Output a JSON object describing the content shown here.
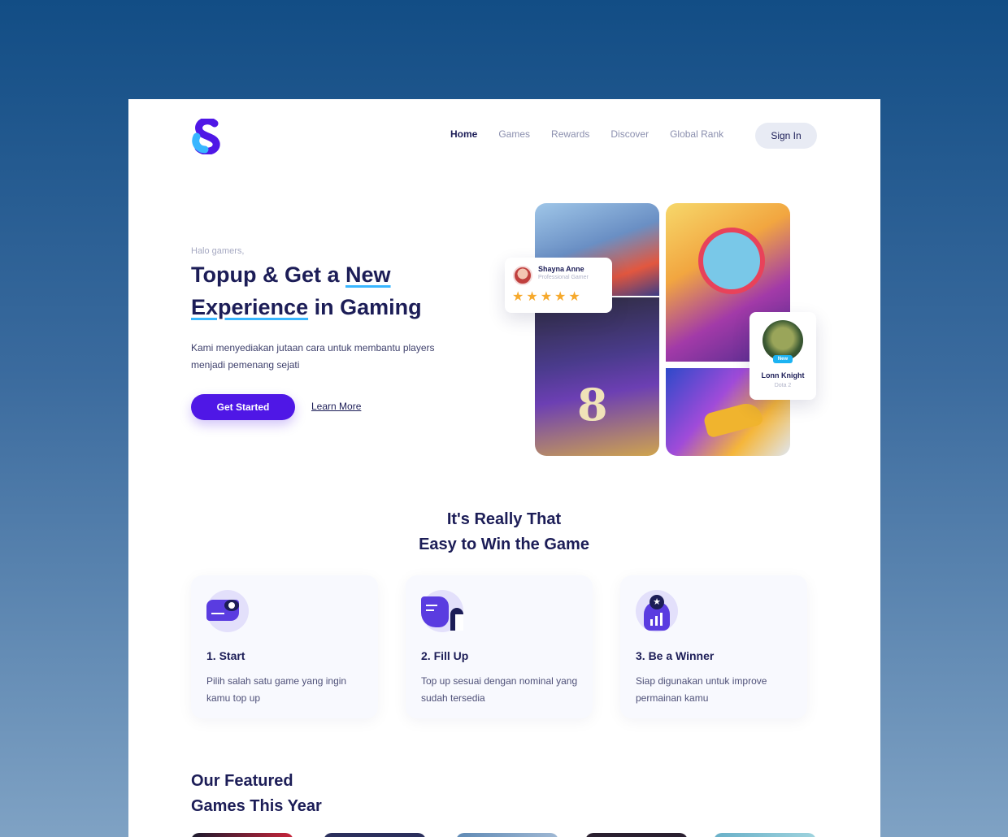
{
  "nav": {
    "items": [
      "Home",
      "Games",
      "Rewards",
      "Discover",
      "Global Rank"
    ],
    "active": "Home",
    "signin_label": "Sign In"
  },
  "brand": {
    "logo": "s-logo-icon",
    "primary": "#4f17e6",
    "accent": "#38b6ff",
    "text": "#1c1d57"
  },
  "hero": {
    "greeting": "Halo gamers,",
    "title_part1": "Topup & Get a ",
    "title_highlight1": "New",
    "title_highlight2": "Experience",
    "title_part2": " in Gaming",
    "description": "Kami menyediakan jutaan cara untuk membantu players menjadi pemenang sejati",
    "cta_label": "Get Started",
    "learn_more_label": "Learn More"
  },
  "collage": {
    "review": {
      "name": "Shayna Anne",
      "role": "Professional Gamer",
      "stars": "★★★★★"
    },
    "profile": {
      "name": "Lonn Knight",
      "game": "Dota 2",
      "badge": "New"
    },
    "jersey_number": "8"
  },
  "steps_section": {
    "title_line1": "It's Really That",
    "title_line2": "Easy to Win the Game",
    "cards": [
      {
        "icon": "game-controller-icon",
        "title": "1. Start",
        "desc": "Pilih salah satu game yang ingin kamu top up"
      },
      {
        "icon": "form-fill-icon",
        "title": "2. Fill Up",
        "desc": "Top up sesuai dengan nominal yang sudah tersedia"
      },
      {
        "icon": "winner-badge-icon",
        "title": "3. Be a Winner",
        "desc": "Siap digunakan untuk improve permainan kamu"
      }
    ]
  },
  "featured": {
    "title_line1": "Our Featured",
    "title_line2": "Games This Year"
  }
}
